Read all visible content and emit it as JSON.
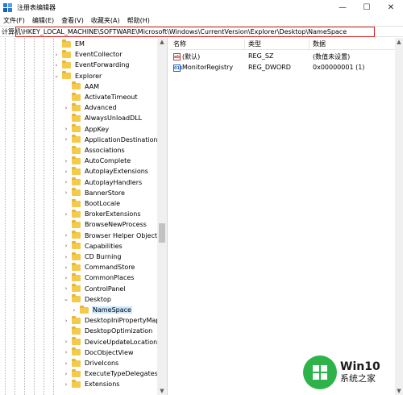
{
  "window": {
    "title": "注册表编辑器",
    "minimize": "—",
    "maximize": "☐",
    "close": "✕"
  },
  "menu": [
    "文件(F)",
    "编辑(E)",
    "查看(V)",
    "收藏夹(A)",
    "帮助(H)"
  ],
  "address": {
    "path": "计算机\\HKEY_LOCAL_MACHINE\\SOFTWARE\\Microsoft\\Windows\\CurrentVersion\\Explorer\\Desktop\\NameSpace",
    "highlight_color": "#e02020"
  },
  "tree": {
    "items": [
      {
        "label": "EM",
        "level": 1,
        "expander": "",
        "selected": false
      },
      {
        "label": "EventCollector",
        "level": 1,
        "expander": ">",
        "selected": false
      },
      {
        "label": "EventForwarding",
        "level": 1,
        "expander": ">",
        "selected": false
      },
      {
        "label": "Explorer",
        "level": 1,
        "expander": "v",
        "selected": false
      },
      {
        "label": "AAM",
        "level": 2,
        "expander": "",
        "selected": false
      },
      {
        "label": "ActivateTimeout",
        "level": 2,
        "expander": "",
        "selected": false
      },
      {
        "label": "Advanced",
        "level": 2,
        "expander": ">",
        "selected": false
      },
      {
        "label": "AlwaysUnloadDLL",
        "level": 2,
        "expander": "",
        "selected": false
      },
      {
        "label": "AppKey",
        "level": 2,
        "expander": ">",
        "selected": false
      },
      {
        "label": "ApplicationDestinations",
        "level": 2,
        "expander": ">",
        "selected": false
      },
      {
        "label": "Associations",
        "level": 2,
        "expander": "",
        "selected": false
      },
      {
        "label": "AutoComplete",
        "level": 2,
        "expander": ">",
        "selected": false
      },
      {
        "label": "AutoplayExtensions",
        "level": 2,
        "expander": ">",
        "selected": false
      },
      {
        "label": "AutoplayHandlers",
        "level": 2,
        "expander": ">",
        "selected": false
      },
      {
        "label": "BannerStore",
        "level": 2,
        "expander": ">",
        "selected": false
      },
      {
        "label": "BootLocale",
        "level": 2,
        "expander": "",
        "selected": false
      },
      {
        "label": "BrokerExtensions",
        "level": 2,
        "expander": ">",
        "selected": false
      },
      {
        "label": "BrowseNewProcess",
        "level": 2,
        "expander": "",
        "selected": false
      },
      {
        "label": "Browser Helper Objects",
        "level": 2,
        "expander": ">",
        "selected": false
      },
      {
        "label": "Capabilities",
        "level": 2,
        "expander": ">",
        "selected": false
      },
      {
        "label": "CD Burning",
        "level": 2,
        "expander": ">",
        "selected": false
      },
      {
        "label": "CommandStore",
        "level": 2,
        "expander": ">",
        "selected": false
      },
      {
        "label": "CommonPlaces",
        "level": 2,
        "expander": ">",
        "selected": false
      },
      {
        "label": "ControlPanel",
        "level": 2,
        "expander": ">",
        "selected": false
      },
      {
        "label": "Desktop",
        "level": 2,
        "expander": "v",
        "selected": false
      },
      {
        "label": "NameSpace",
        "level": 3,
        "expander": ">",
        "selected": true
      },
      {
        "label": "DesktopIniPropertyMap",
        "level": 2,
        "expander": ">",
        "selected": false
      },
      {
        "label": "DesktopOptimization",
        "level": 2,
        "expander": "",
        "selected": false
      },
      {
        "label": "DeviceUpdateLocations",
        "level": 2,
        "expander": ">",
        "selected": false
      },
      {
        "label": "DocObjectView",
        "level": 2,
        "expander": ">",
        "selected": false
      },
      {
        "label": "DriveIcons",
        "level": 2,
        "expander": ">",
        "selected": false
      },
      {
        "label": "ExecuteTypeDelegates",
        "level": 2,
        "expander": ">",
        "selected": false
      },
      {
        "label": "Extensions",
        "level": 2,
        "expander": ">",
        "selected": false
      }
    ],
    "selected_color": "#cce8ff",
    "folder_color": "#f5c94a"
  },
  "values": {
    "columns": {
      "name": "名称",
      "type": "类型",
      "data": "数据"
    },
    "rows": [
      {
        "icon": "string-value-icon",
        "icon_text": "ab",
        "name": "(默认)",
        "type": "REG_SZ",
        "data": "(数值未设置)"
      },
      {
        "icon": "dword-value-icon",
        "icon_text": "011",
        "name": "MonitorRegistry",
        "type": "REG_DWORD",
        "data": "0x00000001 (1)"
      }
    ]
  },
  "watermark": {
    "title": "Win10",
    "subtitle": "系统之家",
    "color": "#2db34a"
  }
}
